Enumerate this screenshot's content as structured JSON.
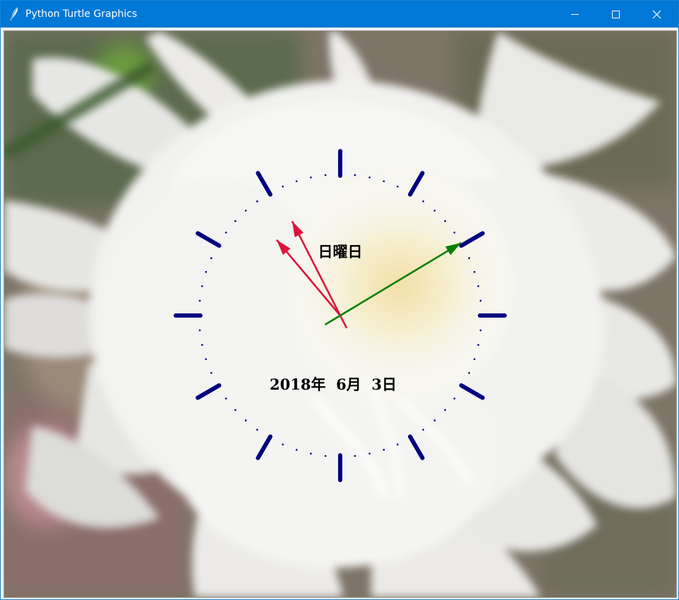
{
  "window": {
    "title": "Python Turtle Graphics",
    "icon": "feather-icon",
    "controls": {
      "minimize": "minimize-icon",
      "maximize": "maximize-icon",
      "close": "close-icon"
    },
    "accent_color": "#0078d7"
  },
  "clock": {
    "weekday_text": "日曜日",
    "date_text": "2018年  6月  3日",
    "hour_marks": 12,
    "minute_dots": 60,
    "tick_color": "#00007f",
    "hands": [
      {
        "name": "second-hand",
        "color": "#dc143c",
        "angle_deg": 333
      },
      {
        "name": "minute-hand",
        "color": "#dc143c",
        "angle_deg": 320
      },
      {
        "name": "hour-hand",
        "color": "#008000",
        "angle_deg": 59
      }
    ]
  },
  "background": {
    "subject": "white-flower-photo"
  }
}
